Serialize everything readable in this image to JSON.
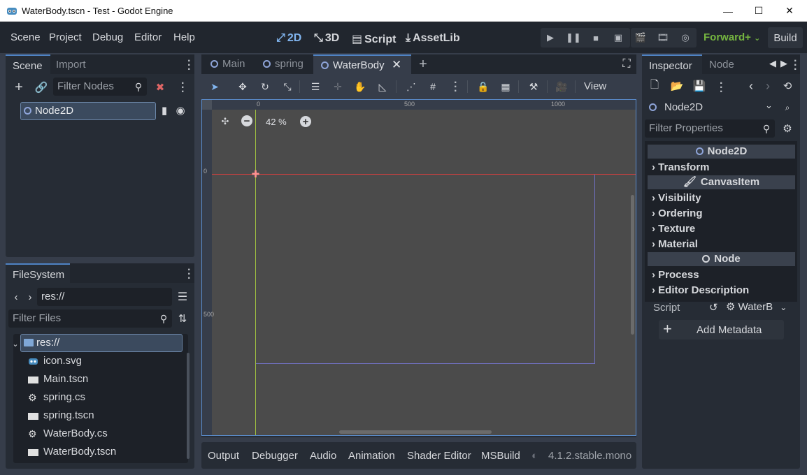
{
  "window": {
    "title": "WaterBody.tscn - Test - Godot Engine",
    "minimize_glyph": "—",
    "maximize_glyph": "☐",
    "close_glyph": "✕"
  },
  "menubar": {
    "items": [
      "Scene",
      "Project",
      "Debug",
      "Editor",
      "Help"
    ],
    "workspaces": [
      {
        "label": "2D",
        "icon": "2d-icon"
      },
      {
        "label": "3D",
        "icon": "3d-icon"
      },
      {
        "label": "Script",
        "icon": "script-icon"
      },
      {
        "label": "AssetLib",
        "icon": "assetlib-icon"
      }
    ],
    "renderer": "Forward+",
    "build": "Build"
  },
  "scene_dock": {
    "tabs": [
      "Scene",
      "Import"
    ],
    "filter_placeholder": "Filter Nodes",
    "root_node": "Node2D"
  },
  "filesystem": {
    "tab": "FileSystem",
    "path": "res://",
    "filter_placeholder": "Filter Files",
    "items": [
      {
        "name": "res://",
        "icon": "folder-icon",
        "selected": true
      },
      {
        "name": "icon.svg",
        "icon": "godot-icon"
      },
      {
        "name": "Main.tscn",
        "icon": "scene-icon"
      },
      {
        "name": "spring.cs",
        "icon": "csharp-icon"
      },
      {
        "name": "spring.tscn",
        "icon": "scene-icon"
      },
      {
        "name": "WaterBody.cs",
        "icon": "csharp-icon"
      },
      {
        "name": "WaterBody.tscn",
        "icon": "scene-icon"
      }
    ]
  },
  "editor_tabs": [
    {
      "label": "Main"
    },
    {
      "label": "spring"
    },
    {
      "label": "WaterBody",
      "active": true
    }
  ],
  "toolbar": {
    "view": "View"
  },
  "viewport": {
    "zoom": "42 %",
    "ruler_h": [
      "0",
      "500",
      "1000"
    ],
    "ruler_v": [
      "0",
      "500"
    ]
  },
  "bottom_panel": {
    "tabs": [
      "Output",
      "Debugger",
      "Audio",
      "Animation",
      "Shader Editor",
      "MSBuild"
    ],
    "version": "4.1.2.stable.mono"
  },
  "inspector": {
    "tabs": [
      "Inspector",
      "Node"
    ],
    "node": "Node2D",
    "filter_placeholder": "Filter Properties",
    "sections": [
      {
        "label": "Node2D",
        "icon": "node2d-icon"
      },
      {
        "label": "CanvasItem",
        "icon": "brush-icon"
      },
      {
        "label": "Node",
        "icon": "node-icon"
      }
    ],
    "categories": {
      "transform": "Transform",
      "visibility": "Visibility",
      "ordering": "Ordering",
      "texture": "Texture",
      "material": "Material",
      "process": "Process",
      "editor_description": "Editor Description"
    },
    "script_label": "Script",
    "script_value": "WaterB",
    "add_metadata": "Add Metadata"
  }
}
